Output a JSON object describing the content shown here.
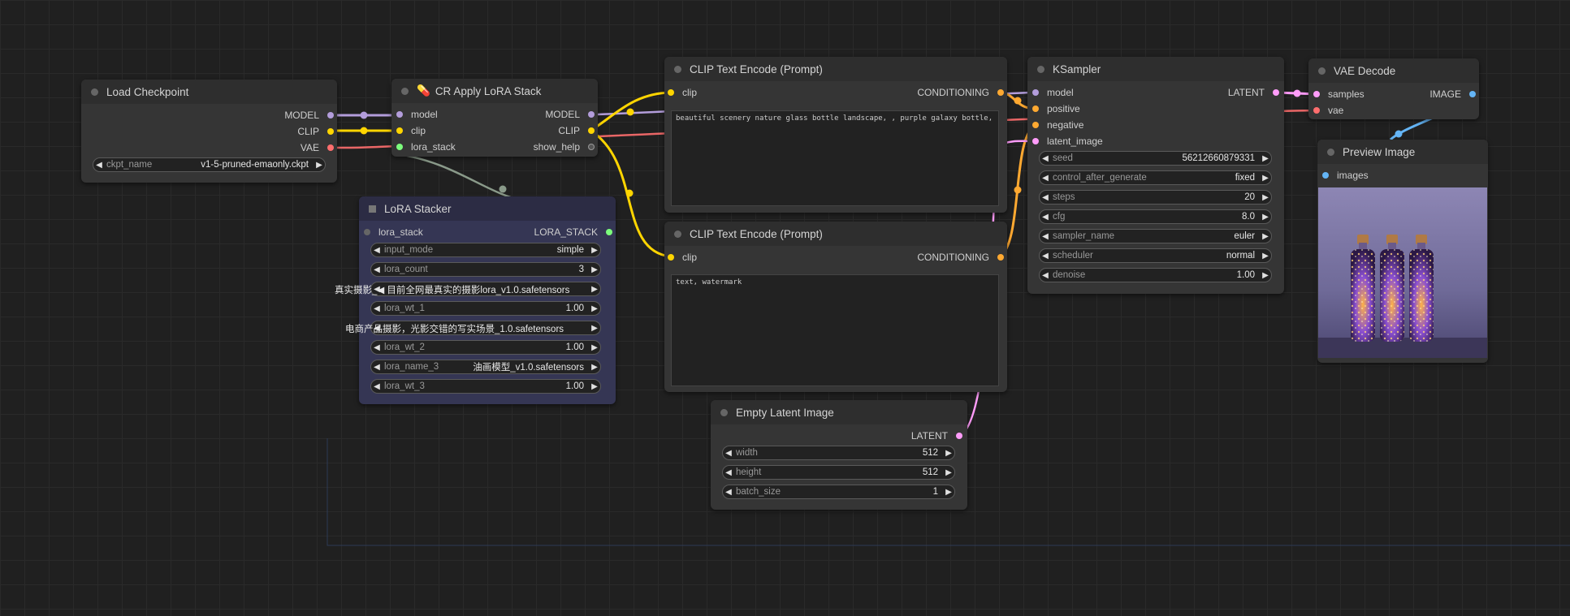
{
  "colors": {
    "clip": "#ffd500",
    "model": "#b39ddb",
    "vae": "#ff6e6e",
    "latent": "#ff9cf9",
    "conditioning": "#ffa931",
    "image": "#64b5f6",
    "lora": "#7cfc7c",
    "gray": "#888888"
  },
  "load_checkpoint": {
    "title": "Load Checkpoint",
    "outputs": [
      "MODEL",
      "CLIP",
      "VAE"
    ],
    "widget": {
      "name": "ckpt_name",
      "value": "v1-5-pruned-emaonly.ckpt"
    }
  },
  "apply_lora": {
    "title": "CR Apply LoRA Stack",
    "inputs": [
      "model",
      "clip",
      "lora_stack"
    ],
    "outputs": [
      "MODEL",
      "CLIP",
      "show_help"
    ]
  },
  "lora_stacker": {
    "title": "LoRA Stacker",
    "input": "lora_stack",
    "output": "LORA_STACK",
    "widgets": [
      {
        "name": "input_mode",
        "value": "simple"
      },
      {
        "name": "lora_count",
        "value": "3"
      },
      {
        "name": "",
        "value": ""
      },
      {
        "name": "lora_wt_1",
        "value": "1.00"
      },
      {
        "name": "",
        "value": ""
      },
      {
        "name": "lora_wt_2",
        "value": "1.00"
      },
      {
        "name": "lora_name_3",
        "value": "油画模型_v1.0.safetensors"
      },
      {
        "name": "lora_wt_3",
        "value": "1.00"
      }
    ],
    "overlay1": "真实摄影_◀ 目前全网最真实的摄影lora_v1.0.safetensors",
    "overlay2": "电商产品摄影，光影交错的写实场景_1.0.safetensors"
  },
  "clip_pos": {
    "title": "CLIP Text Encode (Prompt)",
    "input": "clip",
    "output": "CONDITIONING",
    "text": "beautiful scenery nature glass bottle landscape, , purple galaxy bottle,"
  },
  "clip_neg": {
    "title": "CLIP Text Encode (Prompt)",
    "input": "clip",
    "output": "CONDITIONING",
    "text": "text, watermark"
  },
  "empty_latent": {
    "title": "Empty Latent Image",
    "output": "LATENT",
    "widgets": [
      {
        "name": "width",
        "value": "512"
      },
      {
        "name": "height",
        "value": "512"
      },
      {
        "name": "batch_size",
        "value": "1"
      }
    ]
  },
  "ksampler": {
    "title": "KSampler",
    "inputs": [
      "model",
      "positive",
      "negative",
      "latent_image"
    ],
    "output": "LATENT",
    "widgets": [
      {
        "name": "seed",
        "value": "56212660879331"
      },
      {
        "name": "control_after_generate",
        "value": "fixed"
      },
      {
        "name": "steps",
        "value": "20"
      },
      {
        "name": "cfg",
        "value": "8.0"
      },
      {
        "name": "sampler_name",
        "value": "euler"
      },
      {
        "name": "scheduler",
        "value": "normal"
      },
      {
        "name": "denoise",
        "value": "1.00"
      }
    ]
  },
  "vae_decode": {
    "title": "VAE Decode",
    "inputs": [
      "samples",
      "vae"
    ],
    "output": "IMAGE"
  },
  "preview": {
    "title": "Preview Image",
    "input": "images"
  }
}
